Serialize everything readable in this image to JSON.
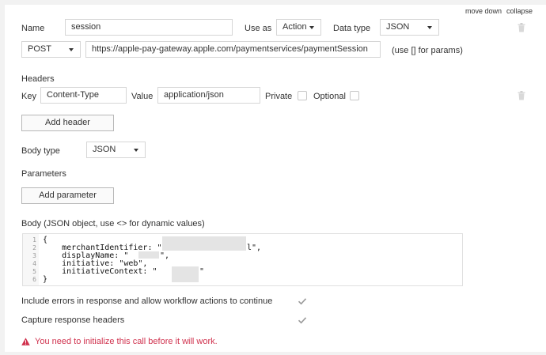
{
  "top_links": {
    "move_down": "move down",
    "collapse": "collapse"
  },
  "call": {
    "name_label": "Name",
    "name_value": "session",
    "use_as_label": "Use as",
    "use_as_value": "Action",
    "data_type_label": "Data type",
    "data_type_value": "JSON",
    "method_value": "POST",
    "url_value": "https://apple-pay-gateway.apple.com/paymentservices/paymentSession",
    "params_hint": "(use [] for params)"
  },
  "headers": {
    "section_label": "Headers",
    "key_label": "Key",
    "key_value": "Content-Type",
    "value_label": "Value",
    "value_value": "application/json",
    "private_label": "Private",
    "optional_label": "Optional",
    "private_checked": false,
    "optional_checked": false,
    "add_header_label": "Add header"
  },
  "body_type": {
    "label": "Body type",
    "value": "JSON"
  },
  "parameters": {
    "label": "Parameters",
    "add_parameter_label": "Add parameter"
  },
  "body": {
    "label": "Body (JSON object, use <> for dynamic values)",
    "line_numbers": [
      "1",
      "2",
      "3",
      "4",
      "5",
      "6"
    ],
    "lines": [
      "{",
      "    merchantIdentifier: \"",
      "    displayName: \"",
      "    initiative: \"web\",",
      "    initiativeContext: \"",
      "}"
    ],
    "line_tails": [
      "",
      "l\",",
      "\",",
      "",
      "\"",
      ""
    ]
  },
  "options": {
    "include_errors_label": "Include errors in response and allow workflow actions to continue",
    "include_errors_checked": true,
    "capture_headers_label": "Capture response headers",
    "capture_headers_checked": true
  },
  "warning": {
    "text": "You need to initialize this call before it will work.",
    "color": "#d0324e"
  },
  "icons": {
    "trash": "trash-icon",
    "warning": "warning-triangle-icon",
    "check": "checkmark-icon",
    "caret": "caret-down-icon"
  },
  "colors": {
    "border": "#d6d6d6",
    "background": "#ffffff",
    "panel": "#f2f2f2"
  }
}
